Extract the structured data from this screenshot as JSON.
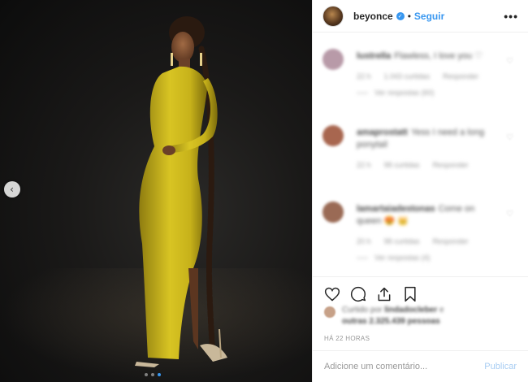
{
  "post": {
    "username": "beyonce",
    "verified_mark": "✓",
    "separator": "•",
    "follow_label": "Seguir",
    "more_label": "•••",
    "prev_arrow": "‹",
    "carousel": {
      "count": 3,
      "active_index": 2
    }
  },
  "comments": [
    {
      "user": "lustrella",
      "text": "Flawless, I love you ♡",
      "meta": [
        "22 h",
        "1.043 curtidas",
        "Responder"
      ],
      "replies": "Ver respostas (60)",
      "avatar_color": "#b89aa8"
    },
    {
      "user": "amaprostatt",
      "text": "Yess I need a long ponytail",
      "meta": [
        "22 h",
        "98 curtidas",
        "Responder"
      ],
      "replies": "",
      "avatar_color": "#a8664f"
    },
    {
      "user": "lamartaiadestonas",
      "text": "Come on queen 😍 👑",
      "meta": [
        "20 h",
        "98 curtidas",
        "Responder"
      ],
      "replies": "Ver respostas (4)",
      "avatar_color": "#9a6a55"
    }
  ],
  "likes": {
    "prefix": "Curtido por",
    "liker": "lindadocleber",
    "conjunction": "e",
    "others": "outras 2.325.439 pessoas"
  },
  "timestamp": "HÁ 22 HORAS",
  "add_comment": {
    "placeholder": "Adicione um comentário...",
    "publish_label": "Publicar"
  },
  "icons": {
    "heart": "heart-icon",
    "comment": "comment-icon",
    "share": "share-icon",
    "bookmark": "bookmark-icon"
  },
  "colors": {
    "accent": "#3897f0",
    "dress": "#c8b21a",
    "background": "#161514"
  }
}
